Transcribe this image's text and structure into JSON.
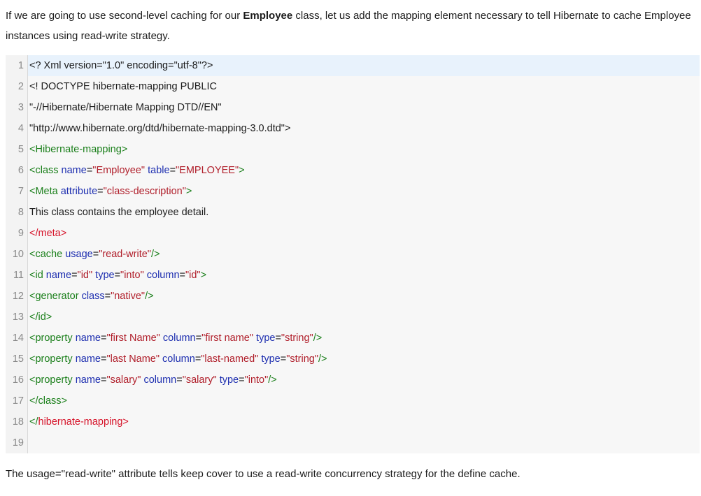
{
  "intro": {
    "before": "If we are going to use second-level caching for our ",
    "bold": "Employee",
    "after": " class, let us add the mapping element necessary to tell Hibernate to cache Employee instances using read-write strategy."
  },
  "code": {
    "lines": [
      {
        "n": "1",
        "tokens": [
          {
            "c": "plain",
            "t": "<? Xml version=\"1.0\" encoding=\"utf-8\"?>"
          }
        ]
      },
      {
        "n": "2",
        "tokens": [
          {
            "c": "plain",
            "t": "<! DOCTYPE hibernate-mapping PUBLIC"
          }
        ]
      },
      {
        "n": "3",
        "tokens": [
          {
            "c": "plain",
            "t": "\"-//Hibernate/Hibernate Mapping DTD//EN\""
          }
        ]
      },
      {
        "n": "4",
        "tokens": [
          {
            "c": "plain",
            "t": "\"http://www.hibernate.org/dtd/hibernate-mapping-3.0.dtd\">"
          }
        ]
      },
      {
        "n": "5",
        "tokens": [
          {
            "c": "tag",
            "t": "<Hibernate-mapping>"
          }
        ]
      },
      {
        "n": "6",
        "tokens": [
          {
            "c": "tag",
            "t": "<class "
          },
          {
            "c": "attr",
            "t": "name"
          },
          {
            "c": "plain",
            "t": "="
          },
          {
            "c": "val",
            "t": "\"Employee\""
          },
          {
            "c": "attr",
            "t": " table"
          },
          {
            "c": "plain",
            "t": "="
          },
          {
            "c": "val",
            "t": "\"EMPLOYEE\""
          },
          {
            "c": "tag",
            "t": ">"
          }
        ]
      },
      {
        "n": "7",
        "tokens": [
          {
            "c": "tag",
            "t": "<Meta "
          },
          {
            "c": "attr",
            "t": "attribute"
          },
          {
            "c": "plain",
            "t": "="
          },
          {
            "c": "val",
            "t": "\"class-description\""
          },
          {
            "c": "tag",
            "t": ">"
          }
        ]
      },
      {
        "n": "8",
        "tokens": [
          {
            "c": "plain",
            "t": "This class contains the employee detail."
          }
        ]
      },
      {
        "n": "9",
        "tokens": [
          {
            "c": "tagred",
            "t": "</meta>"
          }
        ]
      },
      {
        "n": "10",
        "tokens": [
          {
            "c": "tag",
            "t": "<cache "
          },
          {
            "c": "attr",
            "t": "usage"
          },
          {
            "c": "plain",
            "t": "="
          },
          {
            "c": "val",
            "t": "\"read-write\""
          },
          {
            "c": "tag",
            "t": "/>"
          }
        ]
      },
      {
        "n": "11",
        "tokens": [
          {
            "c": "tag",
            "t": "<id "
          },
          {
            "c": "attr",
            "t": "name"
          },
          {
            "c": "plain",
            "t": "="
          },
          {
            "c": "val",
            "t": "\"id\""
          },
          {
            "c": "attr",
            "t": " type"
          },
          {
            "c": "plain",
            "t": "="
          },
          {
            "c": "val",
            "t": "\"into\""
          },
          {
            "c": "attr",
            "t": " column"
          },
          {
            "c": "plain",
            "t": "="
          },
          {
            "c": "val",
            "t": "\"id\""
          },
          {
            "c": "tag",
            "t": ">"
          }
        ]
      },
      {
        "n": "12",
        "tokens": [
          {
            "c": "tag",
            "t": "<generator "
          },
          {
            "c": "attr",
            "t": "class"
          },
          {
            "c": "plain",
            "t": "="
          },
          {
            "c": "val",
            "t": "\"native\""
          },
          {
            "c": "tag",
            "t": "/>"
          }
        ]
      },
      {
        "n": "13",
        "tokens": [
          {
            "c": "tag",
            "t": "</id>"
          }
        ]
      },
      {
        "n": "14",
        "tokens": [
          {
            "c": "tag",
            "t": "<property "
          },
          {
            "c": "attr",
            "t": "name"
          },
          {
            "c": "plain",
            "t": "="
          },
          {
            "c": "val",
            "t": "\"first Name\""
          },
          {
            "c": "attr",
            "t": " column"
          },
          {
            "c": "plain",
            "t": "="
          },
          {
            "c": "val",
            "t": "\"first name\""
          },
          {
            "c": "attr",
            "t": " type"
          },
          {
            "c": "plain",
            "t": "="
          },
          {
            "c": "val",
            "t": "\"string\""
          },
          {
            "c": "tag",
            "t": "/>"
          }
        ]
      },
      {
        "n": "15",
        "tokens": [
          {
            "c": "tag",
            "t": "<property "
          },
          {
            "c": "attr",
            "t": "name"
          },
          {
            "c": "plain",
            "t": "="
          },
          {
            "c": "val",
            "t": "\"last Name\""
          },
          {
            "c": "attr",
            "t": " column"
          },
          {
            "c": "plain",
            "t": "="
          },
          {
            "c": "val",
            "t": "\"last-named\""
          },
          {
            "c": "attr",
            "t": " type"
          },
          {
            "c": "plain",
            "t": "="
          },
          {
            "c": "val",
            "t": "\"string\""
          },
          {
            "c": "tag",
            "t": "/>"
          }
        ]
      },
      {
        "n": "16",
        "tokens": [
          {
            "c": "tag",
            "t": "<property "
          },
          {
            "c": "attr",
            "t": "name"
          },
          {
            "c": "plain",
            "t": "="
          },
          {
            "c": "val",
            "t": "\"salary\""
          },
          {
            "c": "attr",
            "t": " column"
          },
          {
            "c": "plain",
            "t": "="
          },
          {
            "c": "val",
            "t": "\"salary\""
          },
          {
            "c": "attr",
            "t": " type"
          },
          {
            "c": "plain",
            "t": "="
          },
          {
            "c": "val",
            "t": "\"into\""
          },
          {
            "c": "tag",
            "t": "/>"
          }
        ]
      },
      {
        "n": "17",
        "tokens": [
          {
            "c": "tag",
            "t": "</class>"
          }
        ]
      },
      {
        "n": "18",
        "tokens": [
          {
            "c": "tag",
            "t": "</"
          },
          {
            "c": "tagred",
            "t": "hibernate-mapping>"
          }
        ]
      },
      {
        "n": "19",
        "tokens": []
      }
    ]
  },
  "outro": {
    "text": "The usage=\"read-write\" attribute tells keep cover to use a read-write concurrency strategy for the define cache."
  }
}
